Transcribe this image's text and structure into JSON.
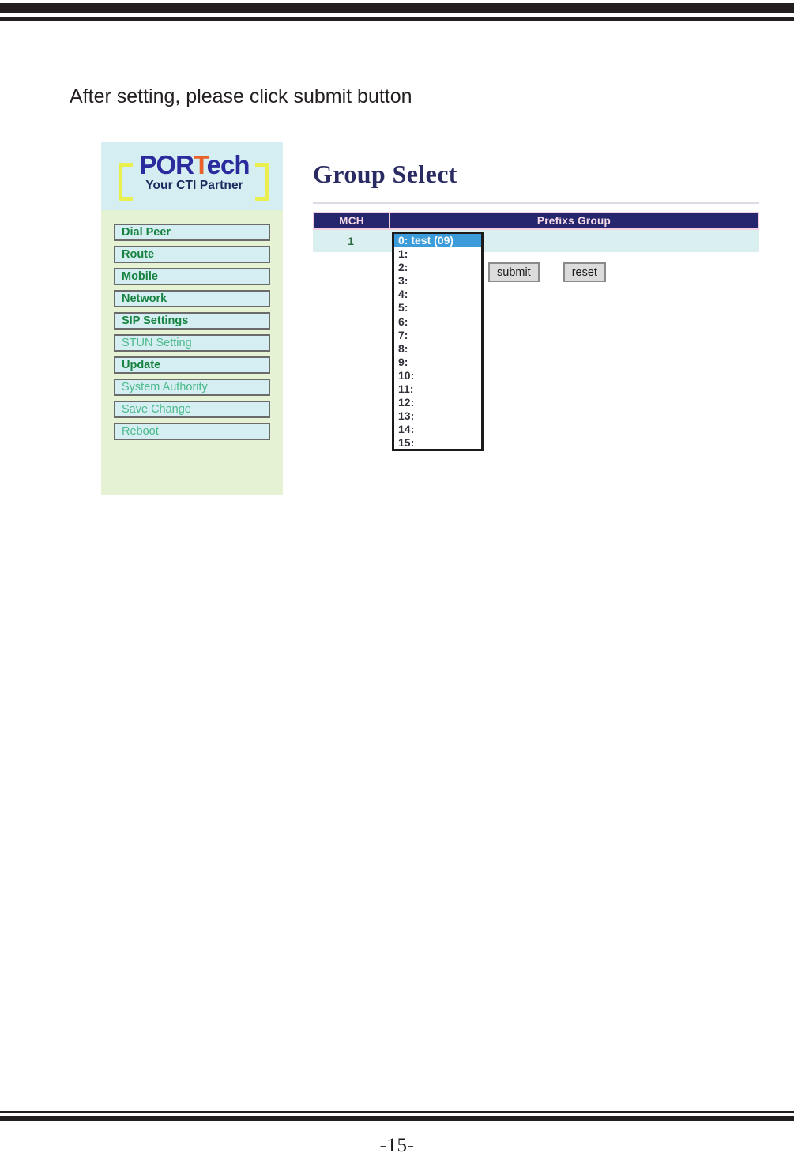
{
  "page": {
    "caption": "After setting, please click submit button",
    "page_number": "-15-"
  },
  "sidebar": {
    "logo": {
      "brand_part1": "POR",
      "brand_accent": "T",
      "brand_part2": "ech",
      "tagline": "Your CTI Partner",
      "brand_color": "#2b2b9e",
      "accent_color": "#e8622a",
      "bracket_color": "#e9ef4f"
    },
    "items": [
      {
        "label": "Dial Peer",
        "emphasis": "strong"
      },
      {
        "label": "Route",
        "emphasis": "strong"
      },
      {
        "label": "Mobile",
        "emphasis": "strong"
      },
      {
        "label": "Network",
        "emphasis": "strong"
      },
      {
        "label": "SIP Settings",
        "emphasis": "strong"
      },
      {
        "label": "STUN Setting",
        "emphasis": "light"
      },
      {
        "label": "Update",
        "emphasis": "strong"
      },
      {
        "label": "System Authority",
        "emphasis": "light"
      },
      {
        "label": "Save Change",
        "emphasis": "light"
      },
      {
        "label": "Reboot",
        "emphasis": "light"
      }
    ]
  },
  "main": {
    "title": "Group Select",
    "table": {
      "headers": [
        "MCH",
        "Prefixs Group"
      ],
      "rows": [
        {
          "mch": "1"
        }
      ]
    },
    "group_select": {
      "selected_index": 0,
      "options": [
        "0: test (09)",
        "1:",
        "2:",
        "3:",
        "4:",
        "5:",
        "6:",
        "7:",
        "8:",
        "9:",
        "10:",
        "11:",
        "12:",
        "13:",
        "14:",
        "15:"
      ]
    },
    "buttons": {
      "submit_label": "submit",
      "reset_label": "reset"
    }
  }
}
